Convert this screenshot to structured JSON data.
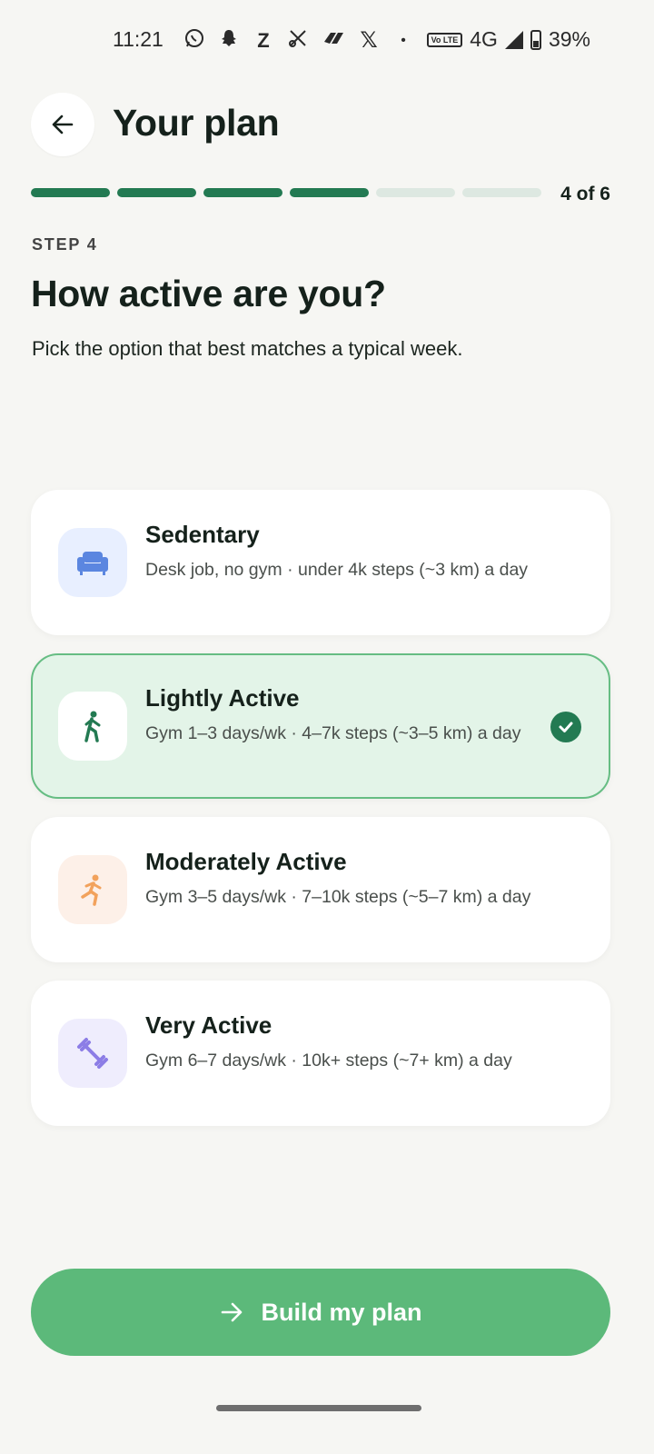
{
  "status_bar": {
    "time": "11:21",
    "left_icons": [
      "whatsapp-icon",
      "snapchat-icon",
      "z-app-icon",
      "tools-icon",
      "paw-icon",
      "x-icon",
      "dot"
    ],
    "volte": "Vo LTE",
    "network": "4G",
    "battery": "39%"
  },
  "header": {
    "title": "Your plan",
    "back_icon": "arrow-left-icon"
  },
  "progress": {
    "current": 4,
    "total": 6,
    "text": "4 of 6"
  },
  "step": {
    "label": "STEP 4",
    "question": "How active are you?",
    "subtitle": "Pick the option that best matches a typical week."
  },
  "options": [
    {
      "title": "Sedentary",
      "description": "Desk job, no gym · under 4k steps (~3 km) a day",
      "icon": "couch-icon",
      "icon_color": "#5b86e0",
      "icon_bg": "#e8efff",
      "selected": false
    },
    {
      "title": "Lightly Active",
      "description": "Gym 1–3 days/wk · 4–7k steps (~3–5 km) a day",
      "icon": "walking-icon",
      "icon_color": "#237a52",
      "icon_bg": "#ffffff",
      "selected": true
    },
    {
      "title": "Moderately Active",
      "description": "Gym 3–5 days/wk · 7–10k steps (~5–7 km) a day",
      "icon": "running-icon",
      "icon_color": "#f2a25c",
      "icon_bg": "#fdf0e8",
      "selected": false
    },
    {
      "title": "Very Active",
      "description": "Gym 6–7 days/wk · 10k+ steps (~7+ km) a day",
      "icon": "dumbbell-icon",
      "icon_color": "#8c7de6",
      "icon_bg": "#efedfd",
      "selected": false
    }
  ],
  "cta": {
    "label": "Build my plan",
    "icon": "arrow-right-icon"
  },
  "colors": {
    "accent": "#237a52",
    "cta": "#5cb97a",
    "selected_bg": "#e3f4e8",
    "background": "#f6f6f3"
  }
}
